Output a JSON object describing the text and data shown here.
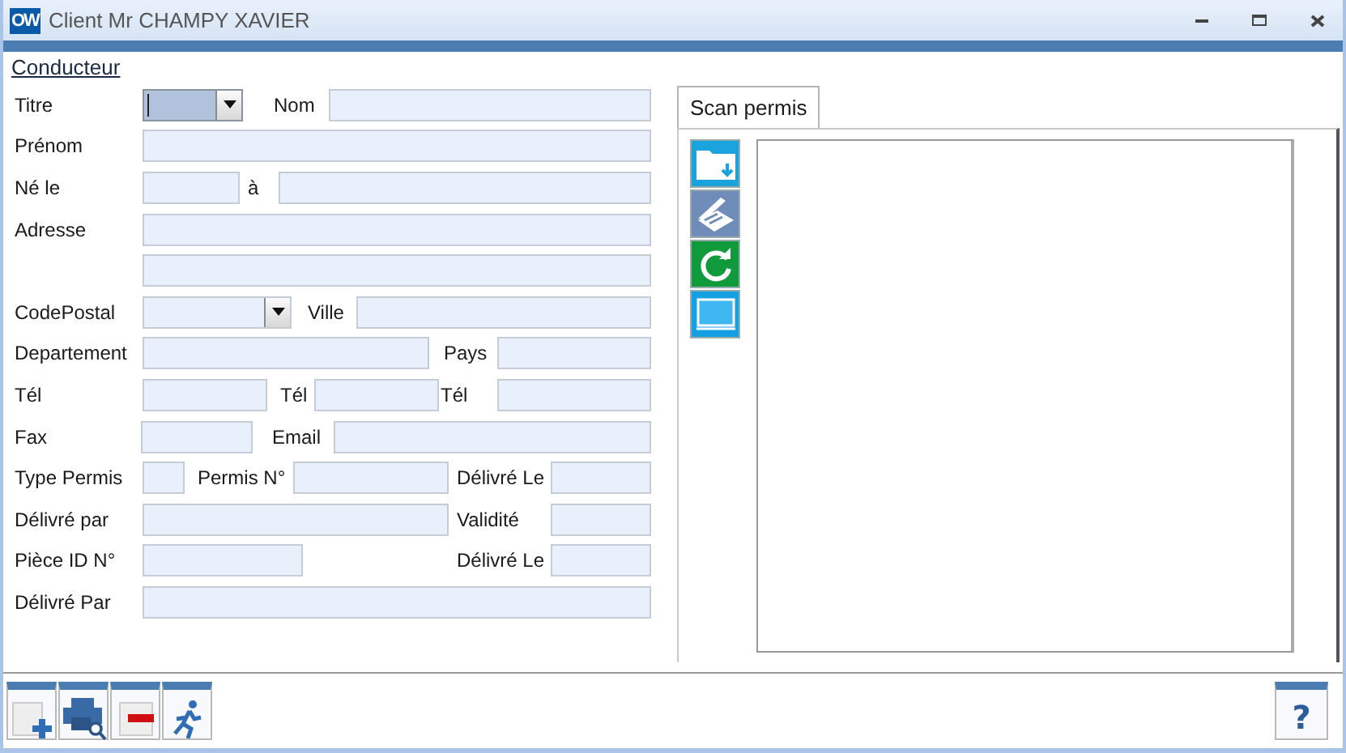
{
  "window": {
    "title": "Client Mr CHAMPY XAVIER",
    "app_badge": "OW"
  },
  "section": {
    "title": "Conducteur"
  },
  "form_rows": [
    {
      "items": [
        {
          "kind": "label",
          "text": "Titre"
        },
        {
          "kind": "combo",
          "focused": true
        },
        {
          "kind": "label",
          "text": "Nom"
        },
        {
          "kind": "field"
        }
      ]
    },
    {
      "items": [
        {
          "kind": "label",
          "text": "Prénom"
        },
        {
          "kind": "field"
        }
      ]
    },
    {
      "items": [
        {
          "kind": "label",
          "text": "Né le"
        },
        {
          "kind": "field"
        },
        {
          "kind": "label",
          "text": "à"
        },
        {
          "kind": "field"
        }
      ]
    },
    {
      "items": [
        {
          "kind": "label",
          "text": "Adresse"
        },
        {
          "kind": "field"
        }
      ]
    },
    {
      "items": [
        {
          "kind": "field"
        }
      ]
    },
    {
      "items": [
        {
          "kind": "label",
          "text": "CodePostal"
        },
        {
          "kind": "combo",
          "focused": false
        },
        {
          "kind": "label",
          "text": "Ville"
        },
        {
          "kind": "field"
        }
      ]
    },
    {
      "items": [
        {
          "kind": "label",
          "text": "Departement"
        },
        {
          "kind": "field"
        },
        {
          "kind": "label",
          "text": "Pays"
        },
        {
          "kind": "field"
        }
      ]
    },
    {
      "items": [
        {
          "kind": "label",
          "text": "Tél"
        },
        {
          "kind": "field"
        },
        {
          "kind": "label",
          "text": "Tél"
        },
        {
          "kind": "field"
        },
        {
          "kind": "label",
          "text": "Tél"
        },
        {
          "kind": "field"
        }
      ]
    },
    {
      "items": [
        {
          "kind": "label",
          "text": "Fax"
        },
        {
          "kind": "field"
        },
        {
          "kind": "label",
          "text": "Email"
        },
        {
          "kind": "field"
        }
      ]
    },
    {
      "items": [
        {
          "kind": "label",
          "text": "Type Permis"
        },
        {
          "kind": "field"
        },
        {
          "kind": "label",
          "text": "Permis N°"
        },
        {
          "kind": "field"
        },
        {
          "kind": "label",
          "text": "Délivré Le"
        },
        {
          "kind": "field"
        }
      ]
    },
    {
      "items": [
        {
          "kind": "label",
          "text": "Délivré par"
        },
        {
          "kind": "field"
        },
        {
          "kind": "label",
          "text": "Validité"
        },
        {
          "kind": "field"
        }
      ]
    },
    {
      "items": [
        {
          "kind": "label",
          "text": "Pièce ID N°"
        },
        {
          "kind": "field"
        },
        {
          "kind": "label",
          "text": "Délivré Le"
        },
        {
          "kind": "field"
        }
      ]
    },
    {
      "items": [
        {
          "kind": "label",
          "text": "Délivré Par"
        },
        {
          "kind": "field"
        }
      ]
    }
  ],
  "tabs": [
    {
      "label": "Scan permis",
      "selected": true
    }
  ],
  "scan_tools": [
    {
      "kind": "import"
    },
    {
      "kind": "scanner"
    },
    {
      "kind": "refresh"
    },
    {
      "kind": "screen"
    }
  ],
  "bottom_buttons": [
    {
      "kind": "add"
    },
    {
      "kind": "print-preview"
    },
    {
      "kind": "remove"
    },
    {
      "kind": "exit"
    }
  ],
  "help_button": {
    "label": "?"
  }
}
